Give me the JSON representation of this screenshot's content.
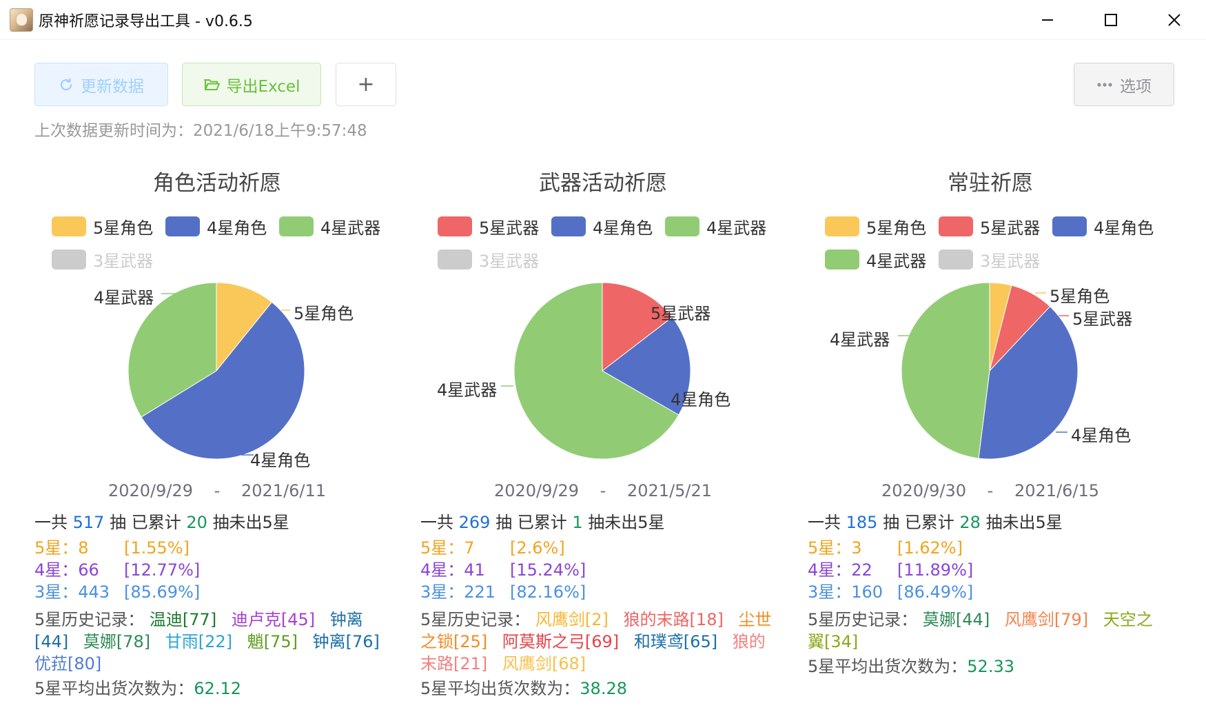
{
  "window": {
    "title": "原神祈愿记录导出工具 - v0.6.5"
  },
  "toolbar": {
    "refresh_label": "更新数据",
    "export_label": "导出Excel",
    "add_label": "+",
    "options_label": "选项"
  },
  "last_update": "上次数据更新时间为：2021/6/18上午9:57:48",
  "colors": {
    "five_star_char": "#fac858",
    "five_star_weapon": "#ee6666",
    "four_star_char": "#5470c6",
    "four_star_weapon": "#91cc75",
    "three_star_weapon": "#cccccc"
  },
  "panels": [
    {
      "title": "角色活动祈愿",
      "legend": [
        {
          "label": "5星角色",
          "key": "five_star_char",
          "enabled": true
        },
        {
          "label": "4星角色",
          "key": "four_star_char",
          "enabled": true
        },
        {
          "label": "4星武器",
          "key": "four_star_weapon",
          "enabled": true
        },
        {
          "label": "3星武器",
          "key": "three_star_weapon",
          "enabled": false
        }
      ],
      "chart_data": {
        "type": "pie",
        "slices": [
          {
            "label": "5星角色",
            "value": 8,
            "key": "five_star_char"
          },
          {
            "label": "4星角色",
            "value": 41,
            "key": "four_star_char"
          },
          {
            "label": "4星武器",
            "value": 25,
            "key": "four_star_weapon"
          }
        ],
        "hidden": [
          {
            "label": "3星武器",
            "value": 443
          }
        ]
      },
      "date_from": "2020/9/29",
      "date_sep": "-",
      "date_to": "2021/6/11",
      "total_prefix": "一共",
      "total": "517",
      "total_mid": "抽 已累计",
      "pity": "20",
      "total_suffix": "抽未出5星",
      "star5": {
        "count": "5星：8",
        "pct": "[1.55%]"
      },
      "star4": {
        "count": "4星：66",
        "pct": "[12.77%]"
      },
      "star3": {
        "count": "3星：443",
        "pct": "[85.69%]"
      },
      "history_label": "5星历史记录：",
      "history": [
        {
          "text": "温迪[77]",
          "color": "#1e7b2f"
        },
        {
          "text": "迪卢克[45]",
          "color": "#a63fd1"
        },
        {
          "text": "钟离[44]",
          "color": "#1c6fa8"
        },
        {
          "text": "莫娜[78]",
          "color": "#2e8b57"
        },
        {
          "text": "甘雨[22]",
          "color": "#2aa3d6"
        },
        {
          "text": "魈[75]",
          "color": "#5e9c1f"
        },
        {
          "text": "钟离[76]",
          "color": "#1c6fa8"
        },
        {
          "text": "优菈[80]",
          "color": "#4f7bd6"
        }
      ],
      "avg_label": "5星平均出货次数为：",
      "avg": "62.12"
    },
    {
      "title": "武器活动祈愿",
      "legend": [
        {
          "label": "5星武器",
          "key": "five_star_weapon",
          "enabled": true
        },
        {
          "label": "4星角色",
          "key": "four_star_char",
          "enabled": true
        },
        {
          "label": "4星武器",
          "key": "four_star_weapon",
          "enabled": true
        },
        {
          "label": "3星武器",
          "key": "three_star_weapon",
          "enabled": false
        }
      ],
      "chart_data": {
        "type": "pie",
        "slices": [
          {
            "label": "5星武器",
            "value": 7,
            "key": "five_star_weapon"
          },
          {
            "label": "4星角色",
            "value": 9,
            "key": "four_star_char"
          },
          {
            "label": "4星武器",
            "value": 32,
            "key": "four_star_weapon"
          }
        ],
        "hidden": [
          {
            "label": "3星武器",
            "value": 221
          }
        ]
      },
      "date_from": "2020/9/29",
      "date_sep": "-",
      "date_to": "2021/5/21",
      "total_prefix": "一共",
      "total": "269",
      "total_mid": "抽 已累计",
      "pity": "1",
      "total_suffix": "抽未出5星",
      "star5": {
        "count": "5星：7",
        "pct": "[2.6%]"
      },
      "star4": {
        "count": "4星：41",
        "pct": "[15.24%]"
      },
      "star3": {
        "count": "3星：221",
        "pct": "[82.16%]"
      },
      "history_label": "5星历史记录：",
      "history": [
        {
          "text": "风鹰剑[2]",
          "color": "#f7b733"
        },
        {
          "text": "狼的末路[18]",
          "color": "#f06464"
        },
        {
          "text": "尘世之锁[25]",
          "color": "#f58a1f"
        },
        {
          "text": "阿莫斯之弓[69]",
          "color": "#e8434a"
        },
        {
          "text": "和璞鸢[65]",
          "color": "#1c6fa8"
        },
        {
          "text": "狼的末路[21]",
          "color": "#f28080"
        },
        {
          "text": "风鹰剑[68]",
          "color": "#f7c04a"
        }
      ],
      "avg_label": "5星平均出货次数为：",
      "avg": "38.28"
    },
    {
      "title": "常驻祈愿",
      "legend": [
        {
          "label": "5星角色",
          "key": "five_star_char",
          "enabled": true
        },
        {
          "label": "5星武器",
          "key": "five_star_weapon",
          "enabled": true
        },
        {
          "label": "4星角色",
          "key": "four_star_char",
          "enabled": true
        },
        {
          "label": "4星武器",
          "key": "four_star_weapon",
          "enabled": true
        },
        {
          "label": "3星武器",
          "key": "three_star_weapon",
          "enabled": false
        }
      ],
      "chart_data": {
        "type": "pie",
        "slices": [
          {
            "label": "5星角色",
            "value": 1,
            "key": "five_star_char"
          },
          {
            "label": "5星武器",
            "value": 2,
            "key": "five_star_weapon"
          },
          {
            "label": "4星角色",
            "value": 10,
            "key": "four_star_char"
          },
          {
            "label": "4星武器",
            "value": 12,
            "key": "four_star_weapon"
          }
        ],
        "hidden": [
          {
            "label": "3星武器",
            "value": 160
          }
        ]
      },
      "date_from": "2020/9/30",
      "date_sep": "-",
      "date_to": "2021/6/15",
      "total_prefix": "一共",
      "total": "185",
      "total_mid": "抽 已累计",
      "pity": "28",
      "total_suffix": "抽未出5星",
      "star5": {
        "count": "5星：3",
        "pct": "[1.62%]"
      },
      "star4": {
        "count": "4星：22",
        "pct": "[11.89%]"
      },
      "star3": {
        "count": "3星：160",
        "pct": "[86.49%]"
      },
      "history_label": "5星历史记录：",
      "history": [
        {
          "text": "莫娜[44]",
          "color": "#2e8b57"
        },
        {
          "text": "风鹰剑[79]",
          "color": "#f5824a"
        },
        {
          "text": "天空之翼[34]",
          "color": "#8aa81a"
        }
      ],
      "avg_label": "5星平均出货次数为：",
      "avg": "52.33"
    }
  ]
}
